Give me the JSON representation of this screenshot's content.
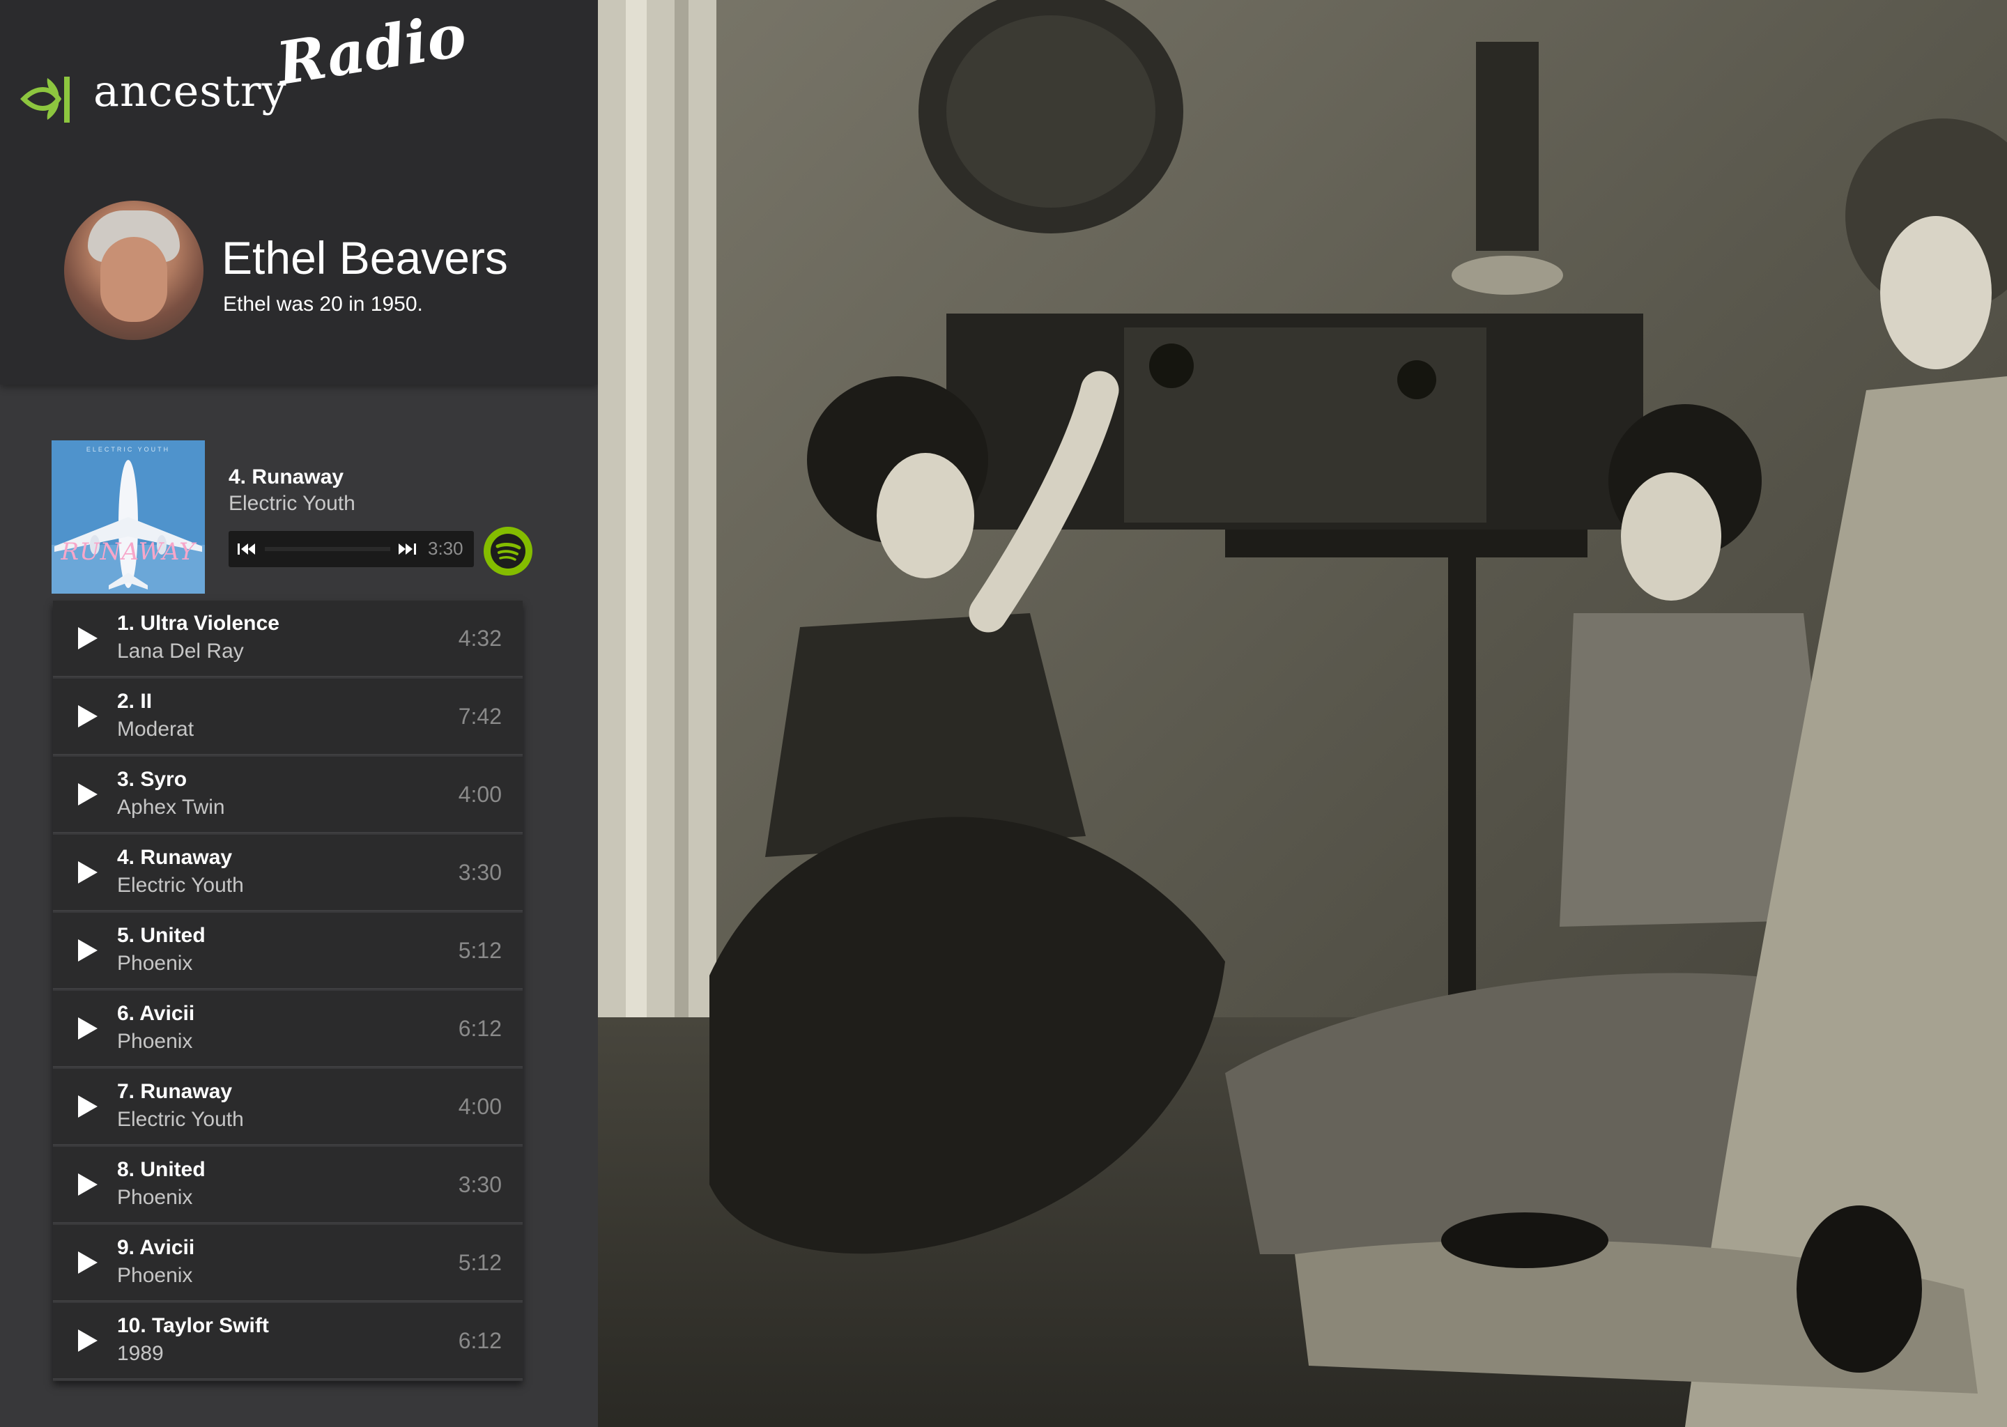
{
  "app": {
    "logo_ancestry": "ancestry",
    "logo_radio": "Radio"
  },
  "colors": {
    "logo_leaf": "#8dc63f",
    "spotify_green": "#84bd00",
    "sidebar_dark": "#2b2b2d",
    "sidebar_panel": "#38383a"
  },
  "profile": {
    "name": "Ethel Beavers",
    "subtitle": "Ethel was 20 in 1950."
  },
  "now_playing": {
    "title": "4. Runaway",
    "artist": "Electric Youth",
    "duration": "3:30",
    "progress": 0.0,
    "album_art_text": "RUNAWAY",
    "album_art_header": "ELECTRIC YOUTH",
    "icons": {
      "previous": "skip-previous-icon",
      "next": "skip-next-icon",
      "spotify": "spotify-icon"
    }
  },
  "tracks": [
    {
      "title": "1. Ultra Violence",
      "artist": "Lana Del Ray",
      "duration": "4:32"
    },
    {
      "title": "2. II",
      "artist": "Moderat",
      "duration": "7:42"
    },
    {
      "title": "3. Syro",
      "artist": "Aphex Twin",
      "duration": "4:00"
    },
    {
      "title": "4. Runaway",
      "artist": "Electric Youth",
      "duration": "3:30"
    },
    {
      "title": "5. United",
      "artist": "Phoenix",
      "duration": "5:12"
    },
    {
      "title": "6. Avicii",
      "artist": "Phoenix",
      "duration": "6:12"
    },
    {
      "title": "7. Runaway",
      "artist": "Electric Youth",
      "duration": "4:00"
    },
    {
      "title": "8. United",
      "artist": "Phoenix",
      "duration": "3:30"
    },
    {
      "title": "9. Avicii",
      "artist": "Phoenix",
      "duration": "5:12"
    },
    {
      "title": "10. Taylor Swift",
      "artist": "1989",
      "duration": "6:12"
    }
  ]
}
